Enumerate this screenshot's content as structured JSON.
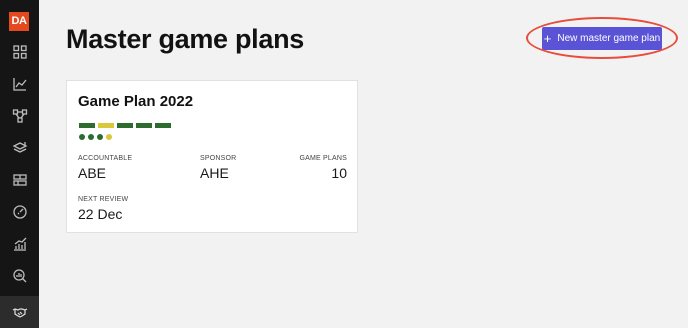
{
  "logo": {
    "text": "DA",
    "color": "#e4491f"
  },
  "sidebar": {
    "items": [
      {
        "icon": "grid-icon"
      },
      {
        "icon": "line-chart-icon"
      },
      {
        "icon": "network-icon"
      },
      {
        "icon": "layers-icon"
      },
      {
        "icon": "table-icon"
      },
      {
        "icon": "gauge-icon"
      },
      {
        "icon": "bar-trend-icon"
      },
      {
        "icon": "search-chart-icon"
      },
      {
        "icon": "handshake-icon",
        "active": true
      }
    ]
  },
  "page": {
    "title": "Master game plans"
  },
  "actions": {
    "new_plan_label": "New master game plan",
    "new_plan_icon": "plus-icon",
    "accent": "#5a53d6"
  },
  "cards": [
    {
      "title": "Game Plan 2022",
      "bars": [
        "#2e6b2e",
        "#d9c93a",
        "#2e6b2e",
        "#2e6b2e",
        "#2e6b2e"
      ],
      "dots": [
        "#2e6b2e",
        "#2e6b2e",
        "#2e6b2e",
        "#d9c93a"
      ],
      "accountable_label": "ACCOUNTABLE",
      "accountable": "ABE",
      "sponsor_label": "SPONSOR",
      "sponsor": "AHE",
      "game_plans_label": "GAME PLANS",
      "game_plans": "10",
      "next_review_label": "NEXT REVIEW",
      "next_review": "22 Dec"
    }
  ]
}
